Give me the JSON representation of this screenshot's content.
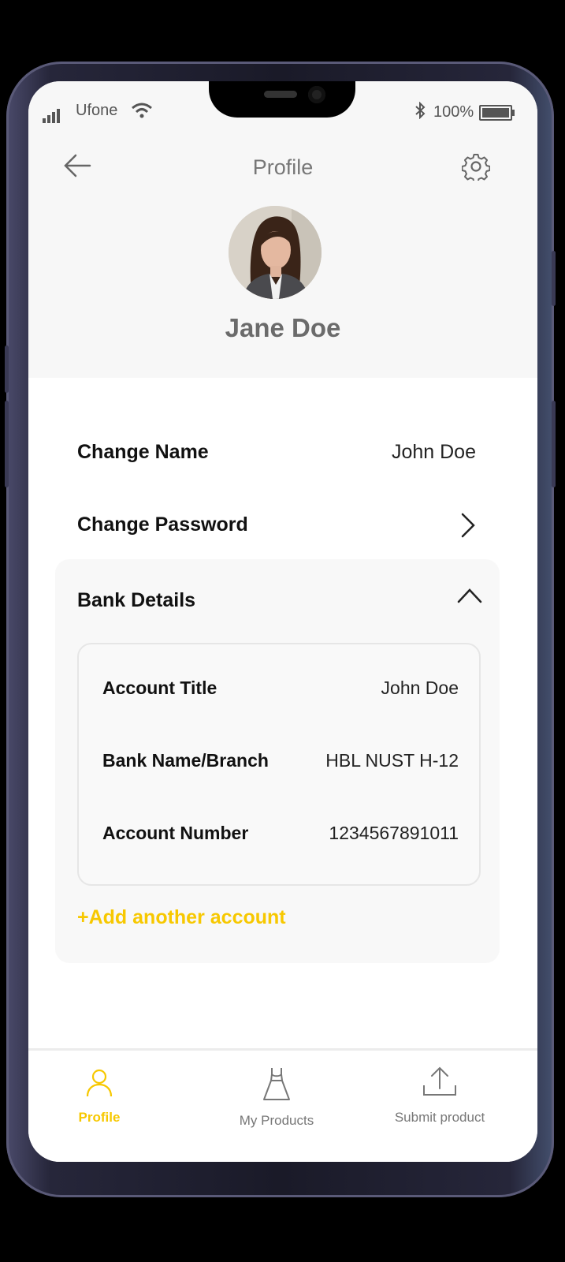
{
  "status_bar": {
    "carrier": "Ufone",
    "battery": "100%"
  },
  "header": {
    "title": "Profile",
    "back_icon": "arrow-left-icon",
    "settings_icon": "gear-icon"
  },
  "profile": {
    "name": "Jane Doe"
  },
  "settings": {
    "change_name_label": "Change Name",
    "change_name_value": "John Doe",
    "change_password_label": "Change Password"
  },
  "bank": {
    "section_label": "Bank Details",
    "rows": [
      {
        "label": "Account Title",
        "value": "John Doe"
      },
      {
        "label": "Bank Name/Branch",
        "value": "HBL NUST H-12"
      },
      {
        "label": "Account Number",
        "value": "1234567891011"
      }
    ],
    "add_label": "+Add another account"
  },
  "tabs": [
    {
      "label": "Profile",
      "icon": "user-icon",
      "active": true
    },
    {
      "label": "My Products",
      "icon": "dress-icon",
      "active": false
    },
    {
      "label": "Submit product",
      "icon": "upload-icon",
      "active": false
    }
  ],
  "colors": {
    "accent": "#f7c800",
    "header_bg": "#f7f7f7",
    "card_bg": "#f8f8f8"
  }
}
